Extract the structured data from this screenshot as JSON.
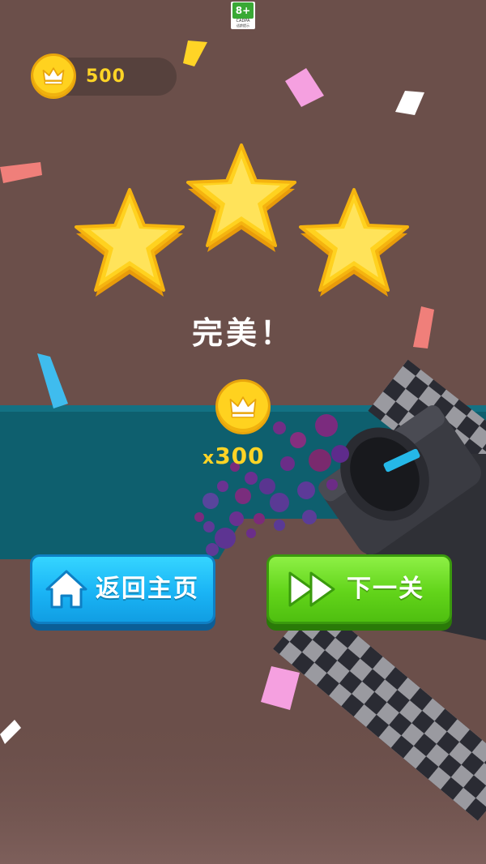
{
  "rating": {
    "badge": "8+",
    "org": "CADPA",
    "note": "适龄提示"
  },
  "wallet": {
    "coins": "500",
    "coin_icon": "crown-coin-icon"
  },
  "result": {
    "stars": 3,
    "title": "完美！",
    "reward": "300",
    "reward_prefix": "x"
  },
  "buttons": {
    "home": {
      "label": "返回主页",
      "icon": "home-icon"
    },
    "next": {
      "label": "下一关",
      "icon": "fast-forward-icon"
    }
  },
  "colors": {
    "background": "#6b4f4a",
    "track": "#0e5f6e",
    "star": "#ffd21f",
    "coin_text": "#ffd426",
    "home_button": "#1ab4f5",
    "next_button": "#62d41a"
  }
}
